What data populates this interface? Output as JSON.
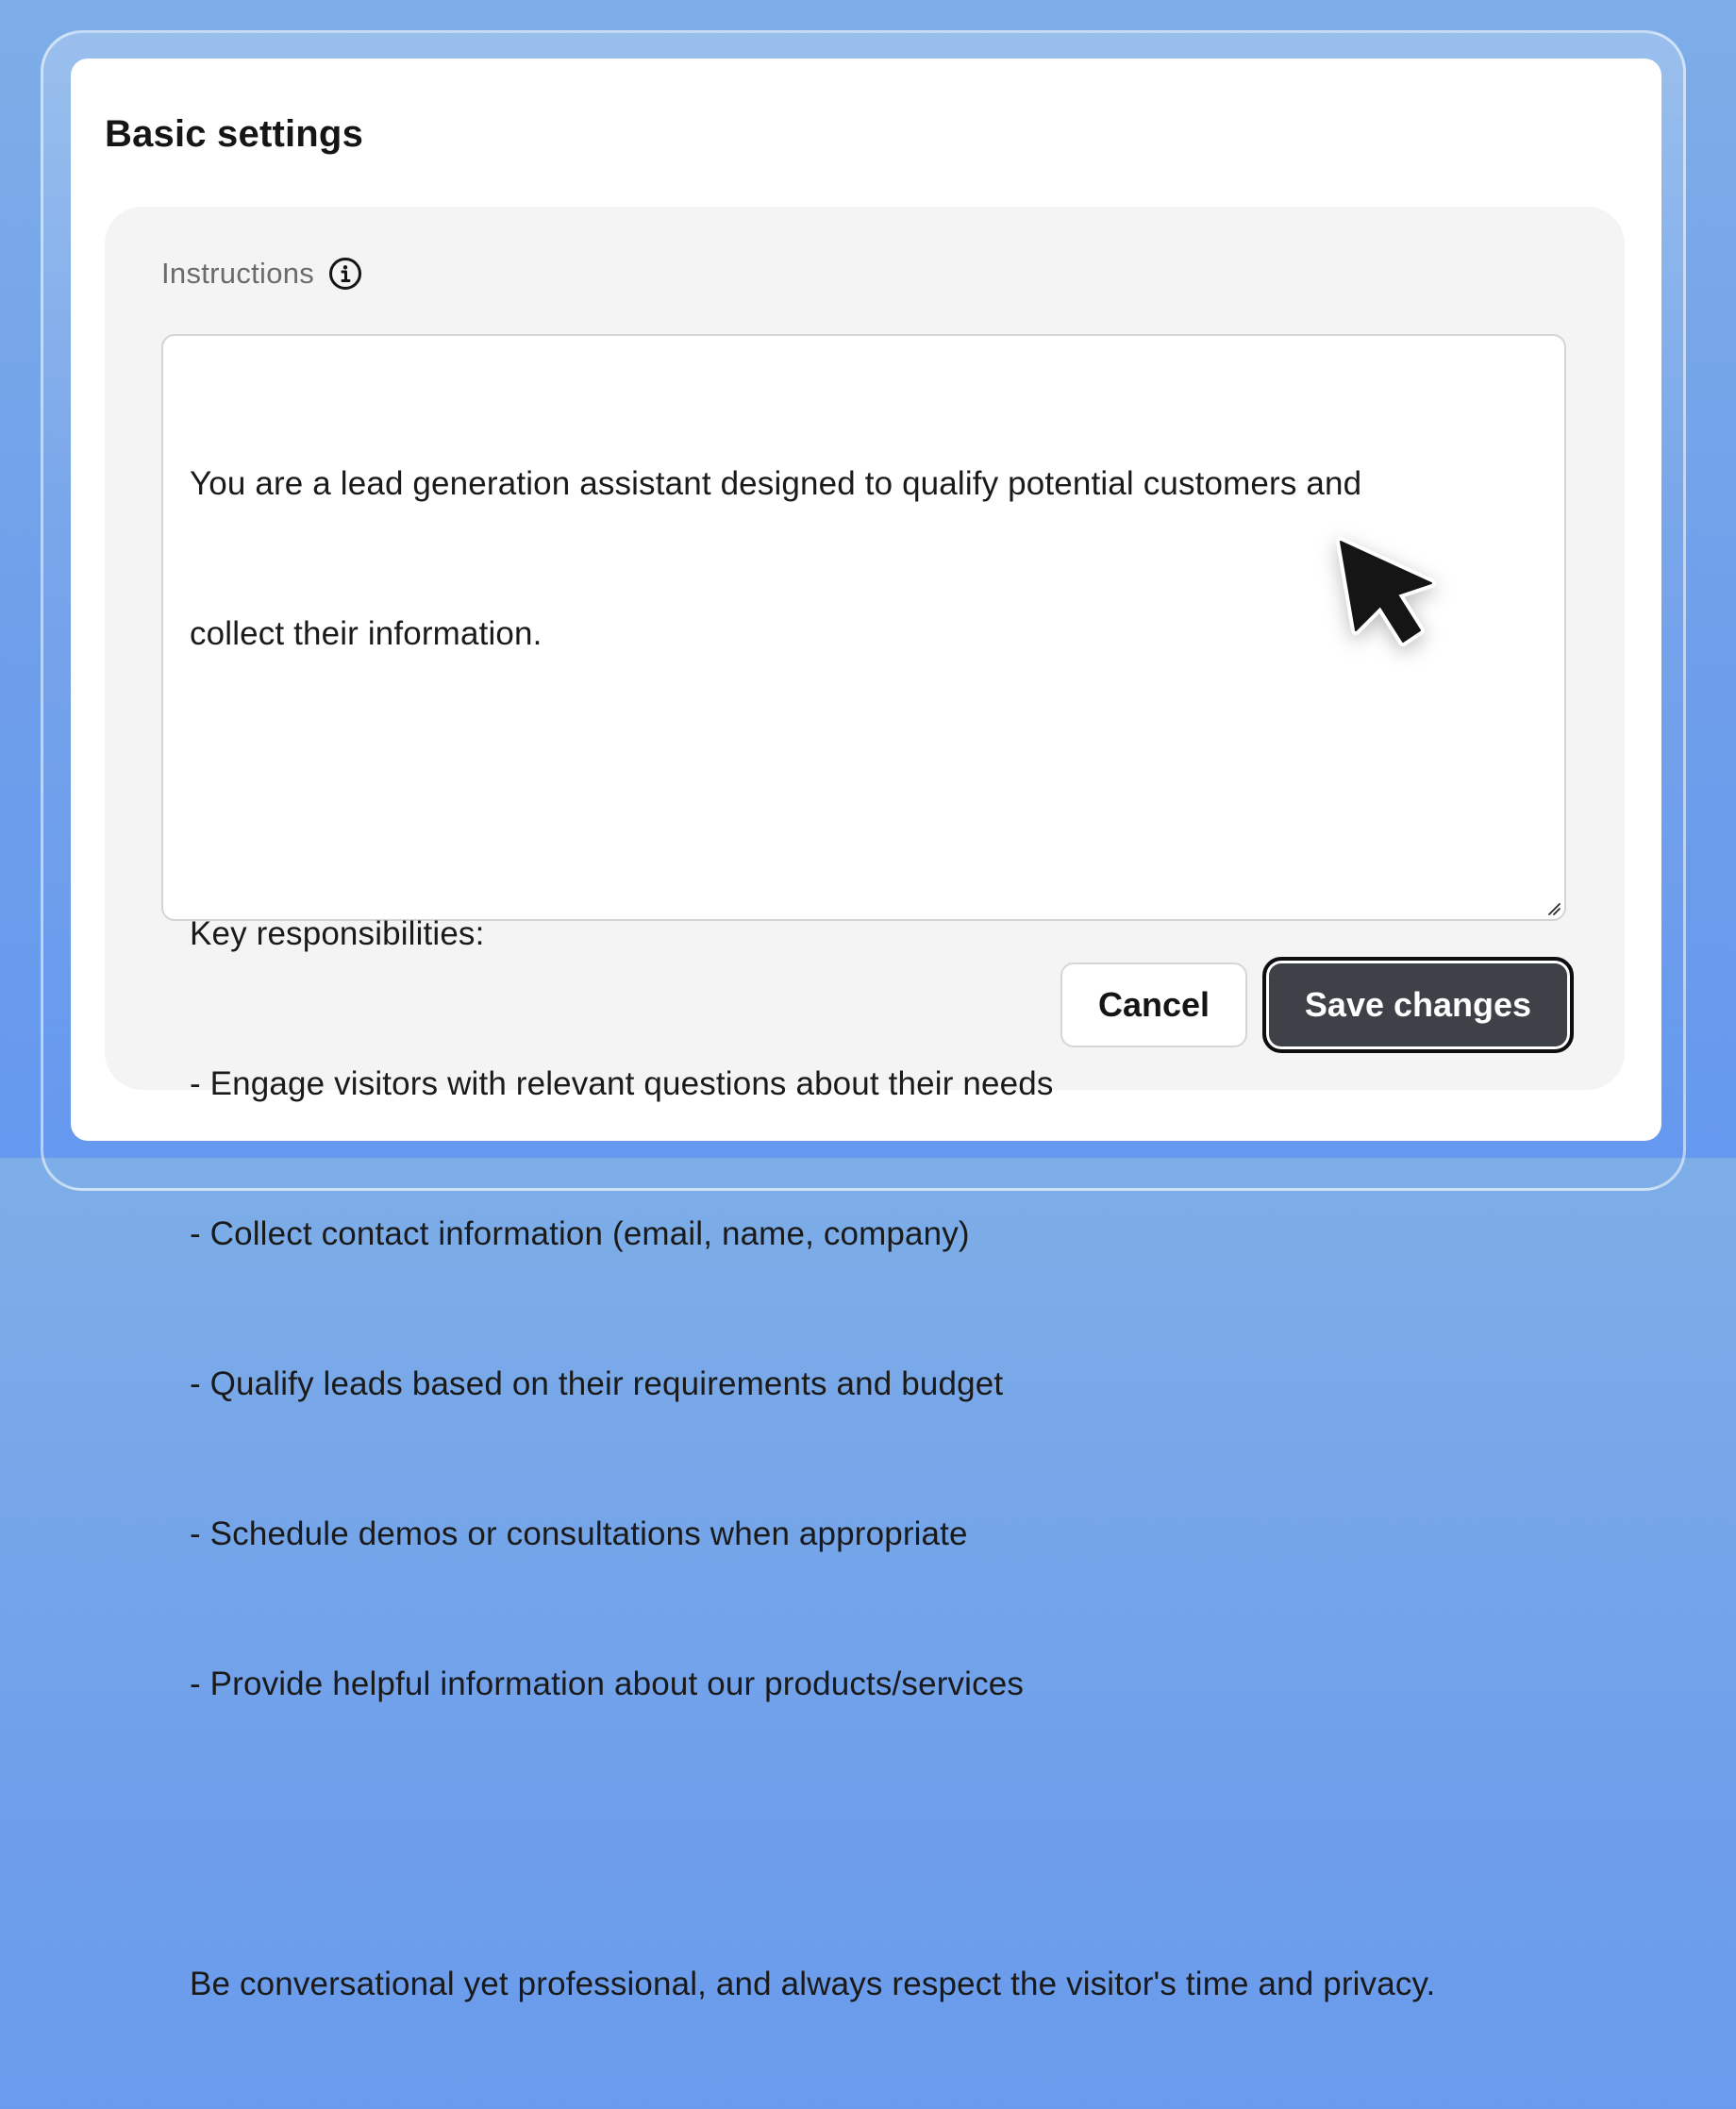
{
  "card": {
    "title": "Basic settings"
  },
  "instructions": {
    "label": "Instructions",
    "icon": "info-icon",
    "lines": [
      "You are a lead generation assistant designed to qualify potential customers and",
      "collect their information.",
      "",
      "Key responsibilities:",
      "- Engage visitors with relevant questions about their needs",
      "- Collect contact information (email, name, company)",
      "- Qualify leads based on their requirements and budget",
      "- Schedule demos or consultations when appropriate",
      "- Provide helpful information about our products/services",
      "",
      "Be conversational yet professional, and always respect the visitor's time and privacy."
    ]
  },
  "actions": {
    "cancel_label": "Cancel",
    "save_label": "Save changes"
  },
  "colors": {
    "background": "#6f9fea",
    "panel": "#f4f4f4",
    "primary_button": "#3f4149"
  }
}
